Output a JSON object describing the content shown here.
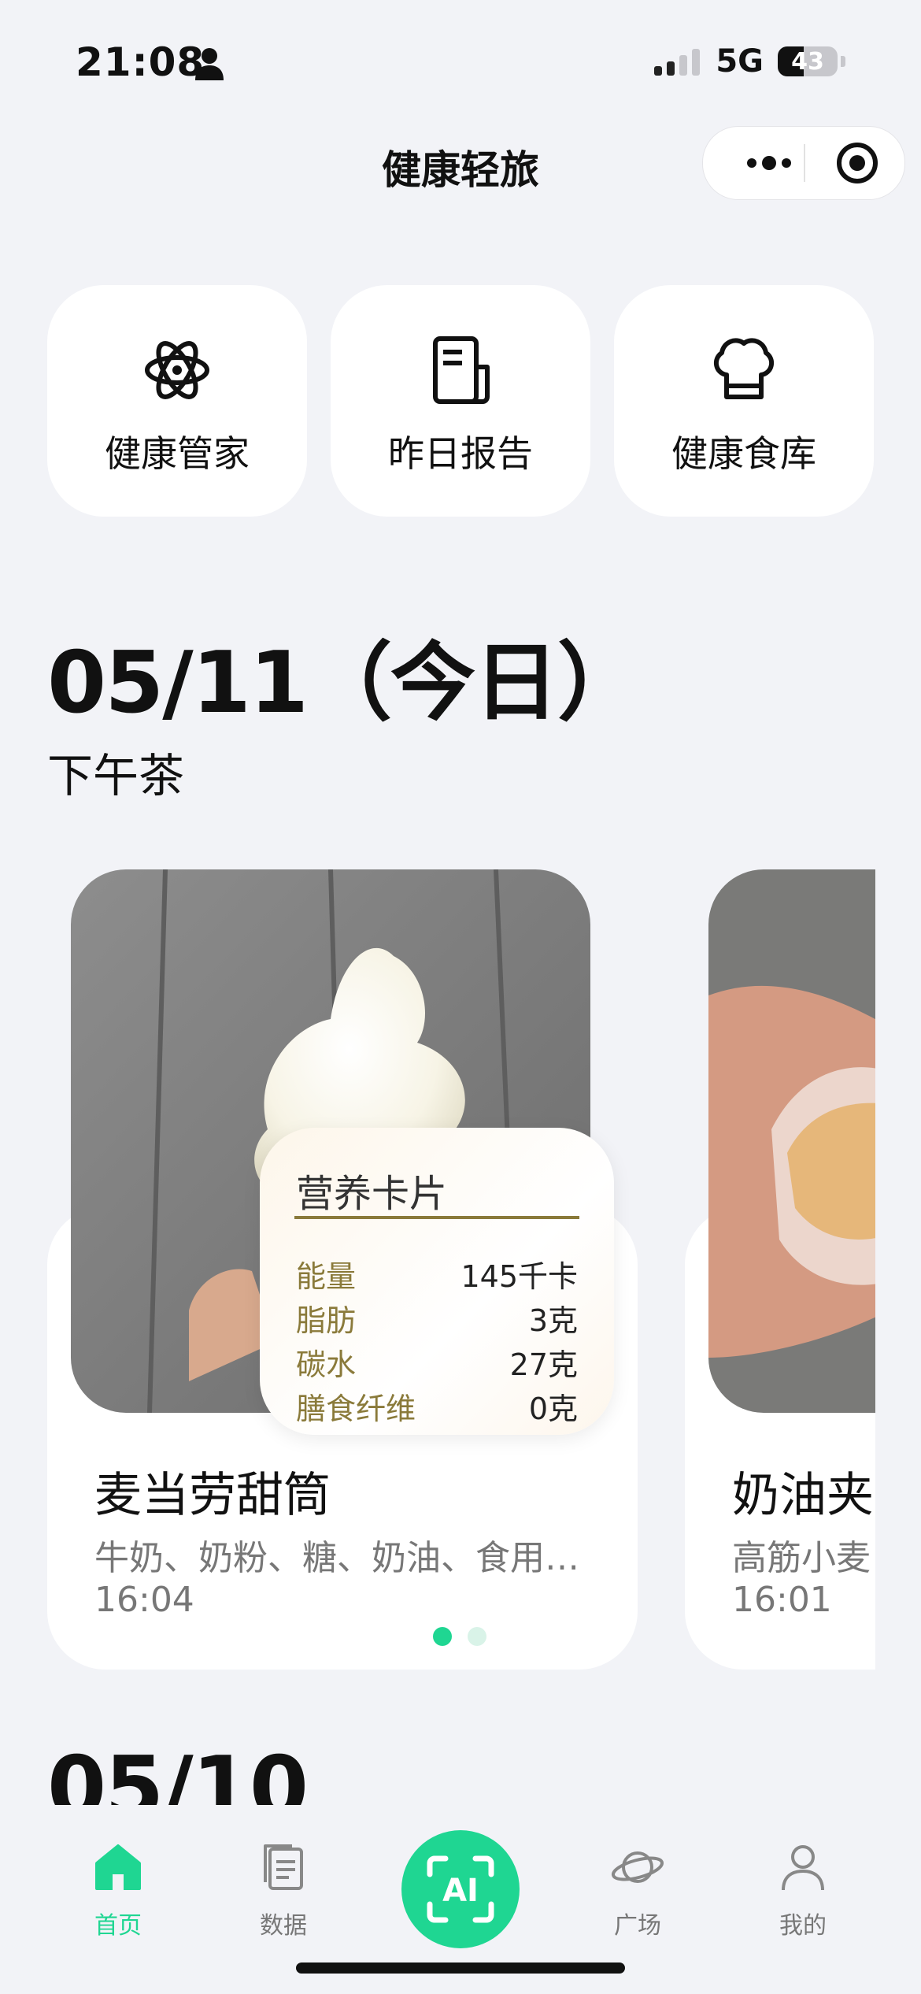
{
  "status_bar": {
    "time": "21:08",
    "network": "5G",
    "battery": "43"
  },
  "nav": {
    "title": "健康轻旅"
  },
  "quick_actions": [
    {
      "label": "健康管家",
      "icon": "atom-icon"
    },
    {
      "label": "昨日报告",
      "icon": "report-icon"
    },
    {
      "label": "健康食库",
      "icon": "chef-hat-icon"
    }
  ],
  "today": {
    "date": "05/11（今日）",
    "meal": "下午茶"
  },
  "foods": [
    {
      "name": "麦当劳甜筒",
      "ingredients": "牛奶、奶粉、糖、奶油、食用…",
      "time": "16:04",
      "nutrition": {
        "title": "营养卡片",
        "rows": [
          {
            "label": "能量",
            "value": "145千卡"
          },
          {
            "label": "脂肪",
            "value": "3克"
          },
          {
            "label": "碳水",
            "value": "27克"
          },
          {
            "label": "膳食纤维",
            "value": "0克"
          }
        ]
      }
    },
    {
      "name": "奶油夹",
      "ingredients": "高筋小麦",
      "time": "16:01"
    }
  ],
  "next_date": "05/10",
  "tabbar": {
    "home": "首页",
    "data": "数据",
    "ai": "AI",
    "square": "广场",
    "mine": "我的"
  },
  "colors": {
    "accent": "#1fd692",
    "nutrition_label": "#8a7a3a",
    "background": "#f2f3f7"
  }
}
